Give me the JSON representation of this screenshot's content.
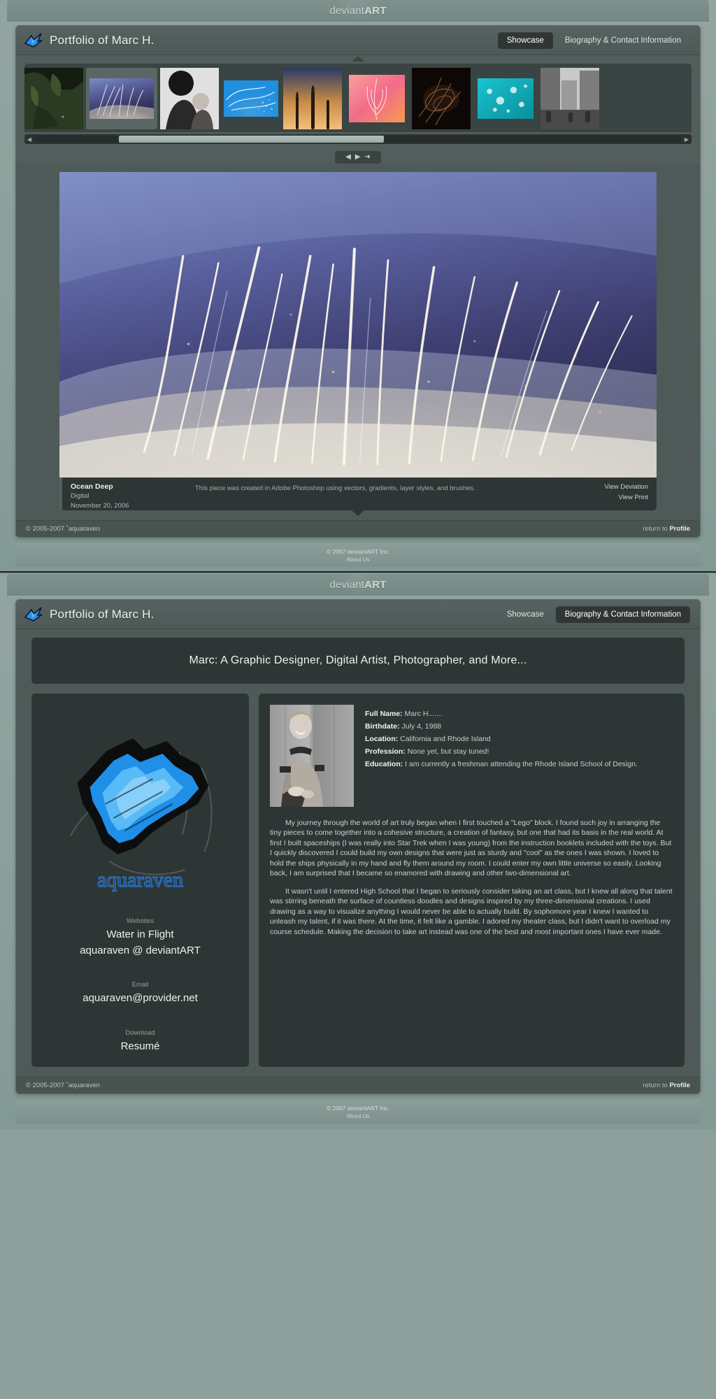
{
  "brand": {
    "logo_text": "deviantART",
    "logo_prefix": "deviant",
    "logo_suffix": "ART"
  },
  "header": {
    "title": "Portfolio of Marc H.",
    "bird_icon": "bird-logo-icon",
    "tabs": [
      {
        "label": "Showcase",
        "active_on_page1": true
      },
      {
        "label": "Biography & Contact Information",
        "active_on_page1": false
      }
    ]
  },
  "gallery": {
    "scroll_left_icon": "chevron-left-icon",
    "scroll_right_icon": "chevron-right-icon",
    "nav_prev_icon": "arrow-left-icon",
    "nav_play_icon": "play-icon",
    "nav_next_icon": "arrow-right-icon",
    "thumbnails": [
      {
        "name": "dark-foliage-photo",
        "selected": false
      },
      {
        "name": "ocean-deep-abstract",
        "selected": true
      },
      {
        "name": "mother-and-child-bw-photo",
        "selected": false
      },
      {
        "name": "blue-light-streaks-abstract",
        "selected": false
      },
      {
        "name": "sunset-cattails-photo",
        "selected": false
      },
      {
        "name": "pink-orange-feather-abstract",
        "selected": false
      },
      {
        "name": "dark-smoke-fractal",
        "selected": false
      },
      {
        "name": "teal-bokeh-abstract",
        "selected": false
      },
      {
        "name": "city-street-bw-photo",
        "selected": false
      }
    ]
  },
  "showcase": {
    "image_name": "ocean-deep-artwork",
    "caption": {
      "title": "Ocean Deep",
      "medium": "Digital",
      "date": "November 20, 2006",
      "description": "This piece was created in Adobe Photoshop using vectors, gradients, layer styles, and brushes.",
      "links": [
        {
          "label": "View Deviation"
        },
        {
          "label": "View Print"
        }
      ]
    }
  },
  "card_footer": {
    "copyright": "© 2005-2007  ˚aquaraven",
    "return_prefix": "return to",
    "return_link": "Profile"
  },
  "global_footer": {
    "copyright": "© 2007 deviantART Inc.",
    "about_link": "About Us"
  },
  "bio": {
    "banner": "Marc: A Graphic Designer, Digital Artist, Photographer, and More...",
    "logo_name": "aquaraven-bird-logo",
    "wordmark": "aquaraven",
    "contact": [
      {
        "label": "Websites",
        "values": [
          "Water in Flight",
          "aquaraven @ deviantART"
        ]
      },
      {
        "label": "Email",
        "values": [
          "aquaraven@provider.net"
        ]
      },
      {
        "label": "Download",
        "values": [
          "Resumé"
        ]
      }
    ],
    "portrait_name": "marc-portrait-photo",
    "facts": [
      {
        "label": "Full Name:",
        "value": "Marc H......."
      },
      {
        "label": "Birthdate:",
        "value": "July 4, 1988"
      },
      {
        "label": "Location:",
        "value": "California and Rhode Island"
      },
      {
        "label": "Profession:",
        "value": "None yet, but stay tuned!"
      },
      {
        "label": "Education:",
        "value": "I am currently a freshman attending the Rhode Island School of Design."
      }
    ],
    "paragraphs": [
      "My journey through the world of art truly began when I first touched a \"Lego\" block. I found such joy in arranging the tiny pieces to come together into a cohesive structure, a creation of fantasy, but one that had its basis in the real world. At first I built spaceships (I was really into Star Trek when I was young) from the instruction booklets included with the toys. But I quickly discovered I could build my own designs that were just as sturdy and \"cool\" as the ones I was shown. I loved to hold the ships physically in my hand and fly them around my room. I could enter my own little universe so easily. Looking back, I am surprised that I became so enamored with drawing and other two-dimensional art.",
      "It wasn't until I entered High School that I began to seriously consider taking an art class, but I knew all along that talent was stirring beneath the surface of countless doodles and designs inspired by my three-dimensional creations. I used drawing as a way to visualize anything I would never be able to actually build. By sophomore year I knew I wanted to unleash my talent, if it was there. At the time, it felt like a gamble. I adored my theater class, but I didn't want to overload my course schedule. Making the decision to take art instead was one of the best and most important ones I have ever made."
    ]
  },
  "colors": {
    "page_bg": "#8ea09c",
    "card_bg": "#4e5a57",
    "panel_dark": "#2e3635",
    "accent_blue": "#2f7fd6",
    "text_light": "#eef3f1"
  }
}
